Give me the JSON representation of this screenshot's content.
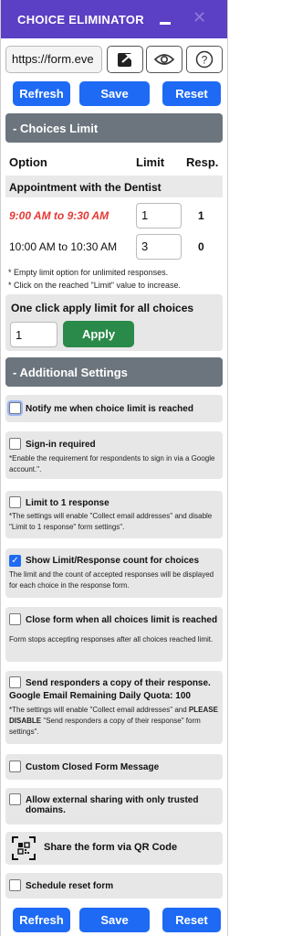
{
  "app": {
    "title": "CHOICE ELIMINATOR"
  },
  "url": {
    "value": "https://form.eve"
  },
  "top_buttons": {
    "refresh": "Refresh",
    "save": "Save",
    "reset": "Reset"
  },
  "choices_section": {
    "header": "- Choices Limit"
  },
  "table": {
    "col_option": "Option",
    "col_limit": "Limit",
    "col_resp": "Resp.",
    "question": "Appointment with the Dentist",
    "rows": [
      {
        "label": "9:00 AM to 9:30 AM",
        "limit": "1",
        "resp": "1",
        "color": "#e53935"
      },
      {
        "label": "10:00 AM to 10:30 AM",
        "limit": "3",
        "resp": "0",
        "color": "#111111"
      }
    ]
  },
  "notes": {
    "line1": "* Empty limit option for unlimited responses.",
    "line2": "* Click on the reached \"Limit\" value to increase."
  },
  "apply_all": {
    "title": "One click apply limit for all choices",
    "value": "1",
    "button": "Apply",
    "button_color": "#2a8a4a"
  },
  "additional_section": {
    "header": "- Additional Settings"
  },
  "settings": {
    "notify": {
      "label": "Notify me when choice limit is reached"
    },
    "signin": {
      "label": "Sign-in required",
      "desc": "*Enable the requirement for respondents to sign in via a Google account.\"."
    },
    "limit1": {
      "label": "Limit to 1 response",
      "desc": "*The settings will enable \"Collect email addresses\" and disable \"Limit to 1 response\" form settings\"."
    },
    "showcount": {
      "label": "Show Limit/Response count for choices",
      "desc": "The limit and the count of accepted responses will be displayed for each choice in the response form."
    },
    "closeform": {
      "label": "Close form when all choices limit is reached",
      "desc": "Form stops accepting responses after all choices reached limit."
    },
    "sendcopy": {
      "label": "Send responders a copy of their response.",
      "quota": "Google Email Remaining Daily Quota: 100",
      "desc_a": "*The settings will enable \"Collect email addresses\" and",
      "desc_b": "PLEASE DISABLE",
      "desc_c": " \"Send responders a copy of their response\" form settings\"."
    },
    "custommsg": {
      "label": "Custom Closed Form Message"
    },
    "external": {
      "label": "Allow external sharing with only trusted domains."
    },
    "qr": {
      "label": "Share the form via QR Code"
    },
    "schedule": {
      "label": "Schedule reset form"
    }
  },
  "bottom_buttons": {
    "refresh": "Refresh",
    "save": "Save",
    "reset": "Reset"
  },
  "colors": {
    "titlebar": "#5b3fc4",
    "primary": "#1e6af5",
    "section": "#6c757d",
    "card": "#e7e7e7"
  },
  "icons": [
    "minimize-icon",
    "close-icon",
    "open-external-icon",
    "eye-icon",
    "help-icon",
    "qr-code-icon"
  ]
}
